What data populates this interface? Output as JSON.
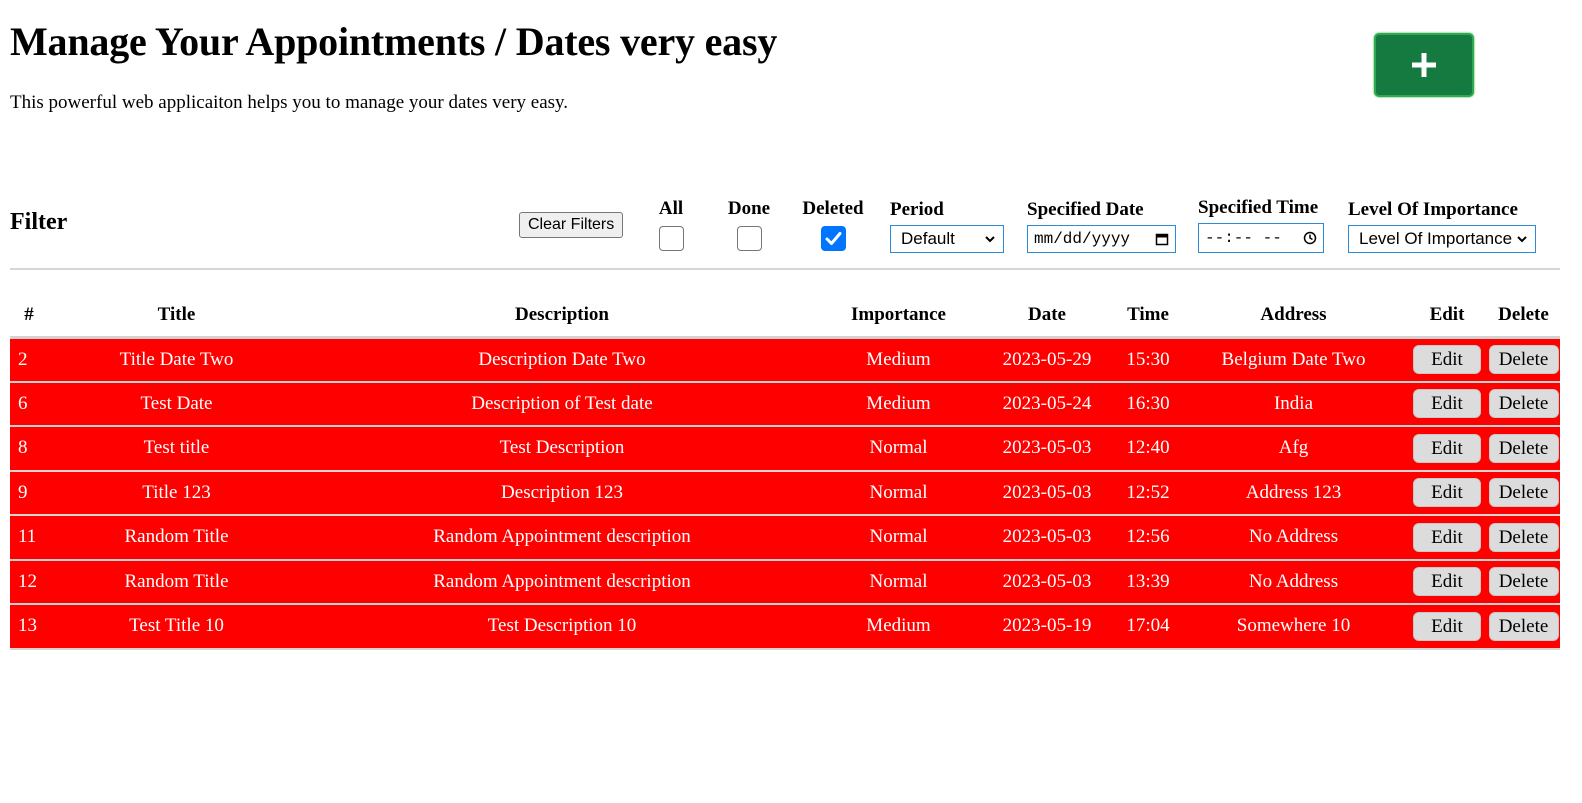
{
  "header": {
    "title": "Manage Your Appointments / Dates very easy",
    "subtitle": "This powerful web applicaiton helps you to manage your dates very easy.",
    "add_button_icon": "plus-icon",
    "add_button_color": "#157a3f"
  },
  "filter": {
    "heading": "Filter",
    "clear_label": "Clear Filters",
    "checkboxes": [
      {
        "label": "All",
        "checked": false
      },
      {
        "label": "Done",
        "checked": false
      },
      {
        "label": "Deleted",
        "checked": true
      }
    ],
    "period": {
      "label": "Period",
      "value": "Default"
    },
    "specified_date": {
      "label": "Specified Date",
      "placeholder": "mm/dd/yyyy"
    },
    "specified_time": {
      "label": "Specified Time",
      "placeholder": "--:-- --"
    },
    "importance": {
      "label": "Level Of Importance",
      "value": "Level Of Importance"
    }
  },
  "table": {
    "headers": [
      "#",
      "Title",
      "Description",
      "Importance",
      "Date",
      "Time",
      "Address",
      "Edit",
      "Delete"
    ],
    "row_color": "#ff0000",
    "edit_label": "Edit",
    "delete_label": "Delete",
    "rows": [
      {
        "id": "2",
        "title": "Title Date Two",
        "description": "Description Date Two",
        "importance": "Medium",
        "date": "2023-05-29",
        "time": "15:30",
        "address": "Belgium Date Two"
      },
      {
        "id": "6",
        "title": "Test Date",
        "description": "Description of Test date",
        "importance": "Medium",
        "date": "2023-05-24",
        "time": "16:30",
        "address": "India"
      },
      {
        "id": "8",
        "title": "Test title",
        "description": "Test Description",
        "importance": "Normal",
        "date": "2023-05-03",
        "time": "12:40",
        "address": "Afg"
      },
      {
        "id": "9",
        "title": "Title 123",
        "description": "Description 123",
        "importance": "Normal",
        "date": "2023-05-03",
        "time": "12:52",
        "address": "Address 123"
      },
      {
        "id": "11",
        "title": "Random Title",
        "description": "Random Appointment description",
        "importance": "Normal",
        "date": "2023-05-03",
        "time": "12:56",
        "address": "No Address"
      },
      {
        "id": "12",
        "title": "Random Title",
        "description": "Random Appointment description",
        "importance": "Normal",
        "date": "2023-05-03",
        "time": "13:39",
        "address": "No Address"
      },
      {
        "id": "13",
        "title": "Test Title 10",
        "description": "Test Description 10",
        "importance": "Medium",
        "date": "2023-05-19",
        "time": "17:04",
        "address": "Somewhere 10"
      }
    ]
  }
}
